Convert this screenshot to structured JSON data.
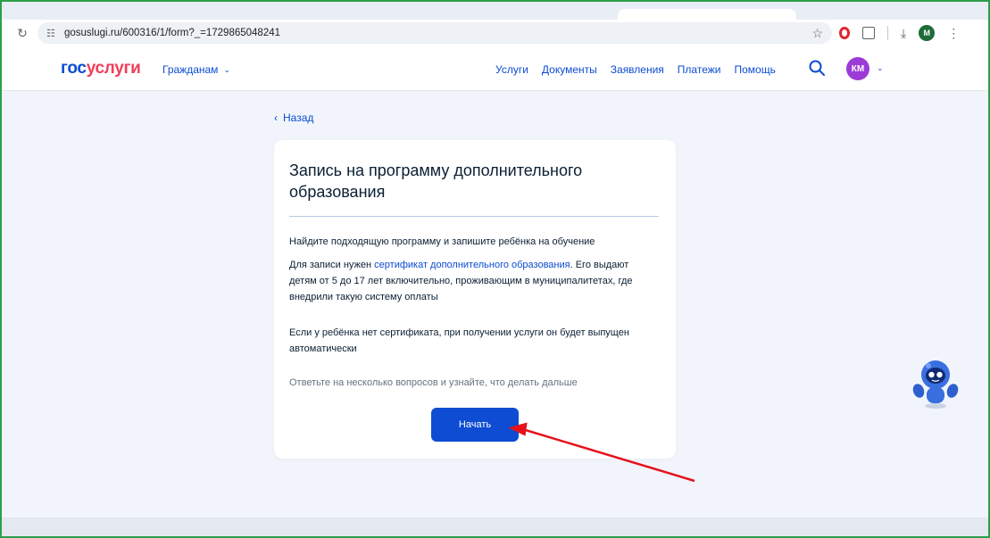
{
  "browser": {
    "url": "gosuslugi.ru/600316/1/form?_=1729865048241",
    "profile_initial": "M",
    "icons": {
      "reload": "reload-icon",
      "site_settings": "site-settings-icon",
      "bookmark": "star-icon",
      "extensions": "puzzle-icon",
      "download": "download-icon",
      "menu": "kebab-menu-icon"
    }
  },
  "header": {
    "logo_part1": "гос",
    "logo_part2": "услуги",
    "citizens_menu": "Гражданам",
    "nav": [
      "Услуги",
      "Документы",
      "Заявления",
      "Платежи",
      "Помощь"
    ],
    "avatar_initials": "КМ"
  },
  "page": {
    "back_label": "Назад",
    "card": {
      "title": "Запись на программу дополнительного образования",
      "intro": "Найдите подходящую программу и запишите ребёнка на обучение",
      "cert_prefix": "Для записи нужен ",
      "cert_link": "сертификат дополнительного образования",
      "cert_suffix": ". Его выдают детям от 5 до 17 лет включительно, проживающим в муниципалитетах, где внедрили такую систему оплаты",
      "no_cert": "Если у ребёнка нет сертификата, при получении услуги он будет выпущен автоматически",
      "questions_hint": "Ответьте на несколько вопросов и узнайте, что делать дальше",
      "start_button": "Начать"
    }
  },
  "colors": {
    "brand_blue": "#0d4cd3",
    "brand_red": "#ee3f58",
    "page_bg": "#f1f5fb",
    "annotation_arrow": "#e5121b",
    "frame_border": "#2e9e4a"
  }
}
